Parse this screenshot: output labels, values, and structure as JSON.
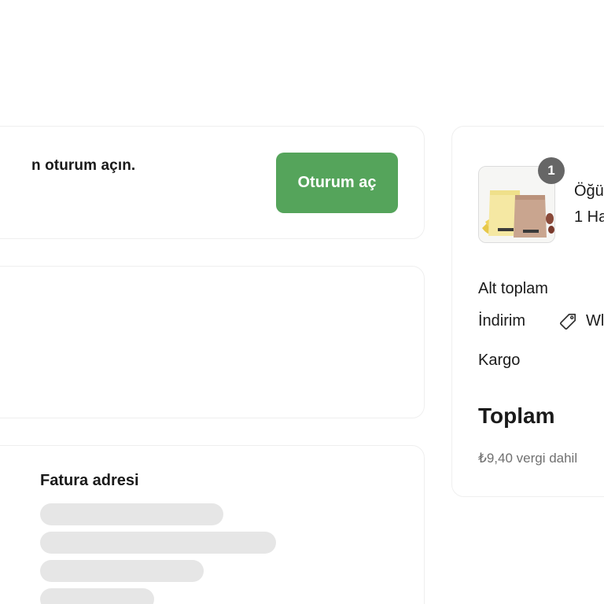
{
  "login": {
    "prompt_text": "n oturum açın.",
    "button_label": "Oturum aç"
  },
  "billing": {
    "title": "Fatura adresi"
  },
  "summary": {
    "item": {
      "quantity": "1",
      "name": "Öğü",
      "variant": "1 Ha",
      "image_icon": "coffee-bags-icon"
    },
    "subtotal_label": "Alt toplam",
    "discount_label": "İndirim",
    "discount_code": "Wl",
    "discount_icon": "tag-icon",
    "shipping_label": "Kargo",
    "total_label": "Toplam",
    "tax_note": "₺9,40 vergi dahil"
  },
  "colors": {
    "accent": "#55a45b",
    "badge": "#666666",
    "skeleton": "#e6e6e6",
    "muted_text": "#707070"
  }
}
